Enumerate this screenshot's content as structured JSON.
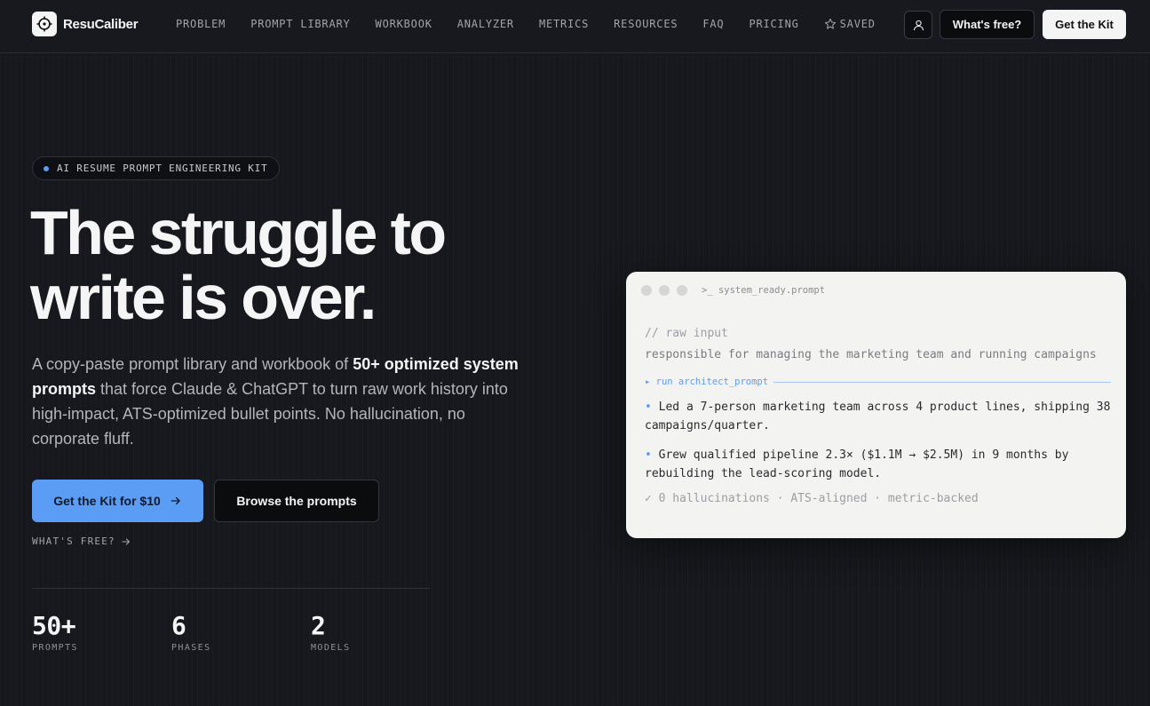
{
  "nav": {
    "brand": "ResuCaliber",
    "links": [
      "PROBLEM",
      "PROMPT LIBRARY",
      "WORKBOOK",
      "ANALYZER",
      "METRICS",
      "RESOURCES",
      "FAQ",
      "PRICING"
    ],
    "saved": "SAVED",
    "whats_free": "What's free?",
    "get_kit": "Get the Kit",
    "icons": [
      "crosshair-logo-icon",
      "star-icon",
      "user-icon"
    ]
  },
  "hero": {
    "badge": "AI RESUME PROMPT ENGINEERING KIT",
    "headline_line1": "The struggle to",
    "headline_line2": "write is over.",
    "lede_1": "A copy-paste prompt library and workbook of ",
    "lede_bold": "50+ optimized system prompts",
    "lede_2": " that force Claude & ChatGPT to turn raw work history into high-impact, ATS-optimized bullet points. No hallucination, no corporate fluff.",
    "cta_primary": "Get the Kit for $10",
    "cta_secondary": "Browse the prompts",
    "whats_free": "WHAT'S FREE?",
    "stats": [
      {
        "num": "50+",
        "label": "PROMPTS"
      },
      {
        "num": "6",
        "label": "PHASES"
      },
      {
        "num": "2",
        "label": "MODELS"
      }
    ]
  },
  "terminal": {
    "title": ">_ system_ready.prompt",
    "comment": "// raw input",
    "raw": "responsible for managing the marketing team and running campaigns",
    "run": "▸ run architect_prompt",
    "bullets": [
      "Led a 7-person marketing team across 4 product lines, shipping 38 campaigns/quarter.",
      "Grew qualified pipeline 2.3× ($1.1M → $2.5M) in 9 months by rebuilding the lead-scoring model."
    ],
    "checks": "✓ 0 hallucinations · ATS-aligned · metric-backed"
  }
}
